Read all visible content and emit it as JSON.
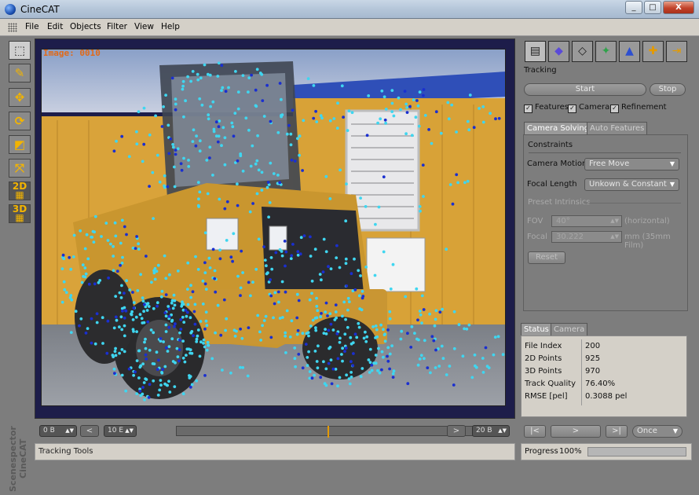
{
  "window": {
    "title": "CineCAT",
    "minimize_label": "_",
    "maximize_label": "□",
    "close_label": "X"
  },
  "menu": [
    "File",
    "Edit",
    "Objects",
    "Filter",
    "View",
    "Help"
  ],
  "tools": [
    {
      "name": "select-tool-icon",
      "glyph": "⬚"
    },
    {
      "name": "lasso-tool-icon",
      "glyph": "✎"
    },
    {
      "name": "move-tool-icon",
      "glyph": "✥"
    },
    {
      "name": "rotate-tool-icon",
      "glyph": "⟳"
    },
    {
      "name": "scale-tool-icon",
      "glyph": "◩"
    },
    {
      "name": "snap-tool-icon",
      "glyph": "⤧"
    },
    {
      "name": "2d-view-icon",
      "glyph": "2D"
    },
    {
      "name": "3d-view-icon",
      "glyph": "3D"
    }
  ],
  "brand": {
    "line1": "Scenespector",
    "line2": "CineCAT"
  },
  "viewport": {
    "image_label": "Image: 0010"
  },
  "timeline": {
    "start_value": "0 B",
    "current_value": "10 E",
    "end_value": "20 B",
    "prev_label": "<",
    "next_label": ">",
    "marker_fraction": 0.5
  },
  "status_left": "Tracking Tools",
  "toolbar_icons": [
    {
      "name": "film-strip-icon",
      "glyph": "▤"
    },
    {
      "name": "object-icon",
      "glyph": "◆"
    },
    {
      "name": "mesh-icon",
      "glyph": "◇"
    },
    {
      "name": "features-icon",
      "glyph": "✦"
    },
    {
      "name": "light-icon",
      "glyph": "▲"
    },
    {
      "name": "target-icon",
      "glyph": "✚"
    },
    {
      "name": "exit-icon",
      "glyph": "⇥"
    }
  ],
  "tracking": {
    "title": "Tracking",
    "start_label": "Start",
    "stop_label": "Stop",
    "features_label": "Features",
    "camera_label": "Camera",
    "refinement_label": "Refinement"
  },
  "solving_tabs": {
    "active": "Camera Solving",
    "inactive": "Auto Features"
  },
  "constraints": {
    "title": "Constraints",
    "camera_motion_label": "Camera Motion",
    "camera_motion_value": "Free Move",
    "focal_length_label": "Focal Length",
    "focal_length_value": "Unkown & Constant"
  },
  "intrinsics": {
    "title": "Preset Intrinsics",
    "fov_label": "FOV",
    "fov_value": "40°",
    "fov_unit": "(horizontal)",
    "focal_label": "Focal",
    "focal_value": "30.222",
    "focal_unit": "mm (35mm Film)",
    "reset_label": "Reset"
  },
  "status_tabs": {
    "active": "Status",
    "inactive": "Camera"
  },
  "status": [
    {
      "key": "File Index",
      "value": "200"
    },
    {
      "key": "2D Points",
      "value": "925"
    },
    {
      "key": "3D Points",
      "value": "970"
    },
    {
      "key": "Track Quality",
      "value": "76.40%"
    },
    {
      "key": "RMSE [pel]",
      "value": "0.3088 pel"
    }
  ],
  "playback": {
    "first_label": "|<",
    "play_label": ">",
    "last_label": ">|",
    "mode_value": "Once"
  },
  "progress": {
    "label": "Progress",
    "value": "100%",
    "fraction": 1.0
  },
  "colors": {
    "accent_orange": "#e49a00",
    "track_cyan": "#3fd6f0",
    "track_blue": "#1a2fd0",
    "viewport_frame": "#1d1d4a"
  }
}
